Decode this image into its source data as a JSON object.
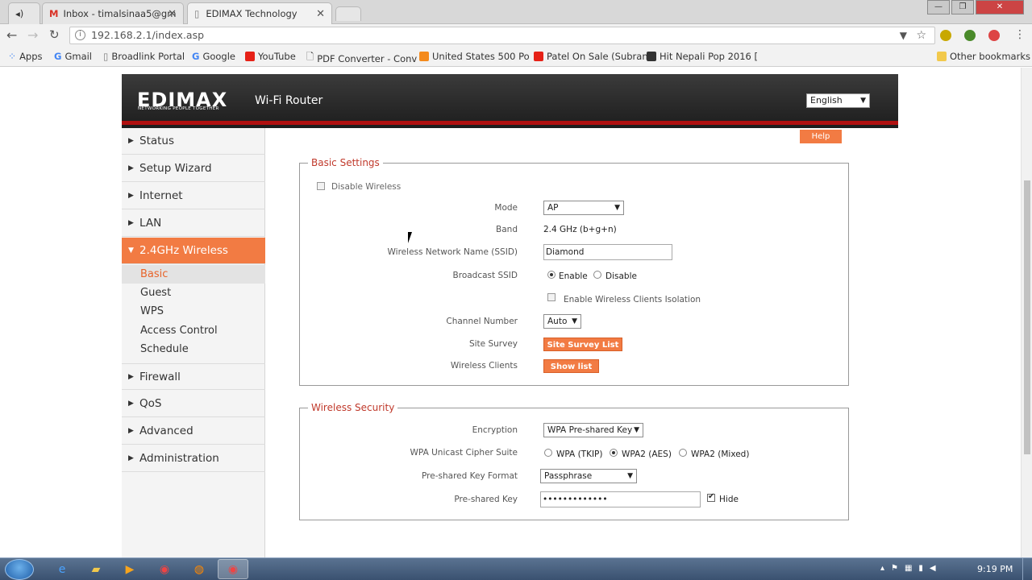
{
  "browser": {
    "tabs": [
      {
        "title": "Inbox - timalsinaa5@gm",
        "close": "✕"
      },
      {
        "title": "EDIMAX Technology",
        "close": "✕"
      }
    ],
    "url": "192.168.2.1/index.asp",
    "bookmarks": [
      {
        "label": "Apps",
        "icon": "apps-icon"
      },
      {
        "label": "Gmail",
        "icon": "google-icon"
      },
      {
        "label": "Broadlink Portal",
        "icon": "page-icon"
      },
      {
        "label": "Google",
        "icon": "google-icon"
      },
      {
        "label": "YouTube",
        "icon": "youtube-icon"
      },
      {
        "label": "PDF Converter - Conv",
        "icon": "pdf-icon"
      },
      {
        "label": "United States 500 Po",
        "icon": "bookmark-icon"
      },
      {
        "label": "Patel On Sale (Subran",
        "icon": "youtube-icon"
      },
      {
        "label": "Hit Nepali Pop 2016 [",
        "icon": "music-icon"
      }
    ],
    "other_bookmarks": "Other bookmarks"
  },
  "router": {
    "logo": "EDIMAX",
    "logo_tagline": "NETWORKING PEOPLE TOGETHER",
    "title": "Wi-Fi Router",
    "language": "English",
    "help": "Help"
  },
  "sidebar": {
    "items": [
      {
        "label": "Status"
      },
      {
        "label": "Setup Wizard"
      },
      {
        "label": "Internet"
      },
      {
        "label": "LAN"
      },
      {
        "label": "2.4GHz Wireless"
      },
      {
        "label": "Firewall"
      },
      {
        "label": "QoS"
      },
      {
        "label": "Advanced"
      },
      {
        "label": "Administration"
      }
    ],
    "subitems": [
      {
        "label": "Basic"
      },
      {
        "label": "Guest"
      },
      {
        "label": "WPS"
      },
      {
        "label": "Access Control"
      },
      {
        "label": "Schedule"
      }
    ]
  },
  "basic_settings": {
    "legend": "Basic Settings",
    "disable_wireless": "Disable  Wireless",
    "mode_label": "Mode",
    "mode_value": "AP",
    "band_label": "Band",
    "band_value": "2.4 GHz (b+g+n)",
    "ssid_label": "Wireless Network Name (SSID)",
    "ssid_value": "Diamond",
    "broadcast_label": "Broadcast SSID",
    "broadcast_enable": "Enable",
    "broadcast_disable": "Disable",
    "isolation_label": "Enable Wireless Clients Isolation",
    "channel_label": "Channel Number",
    "channel_value": "Auto",
    "site_survey_label": "Site Survey",
    "site_survey_button": "Site Survey List",
    "clients_label": "Wireless Clients",
    "clients_button": "Show list"
  },
  "wireless_security": {
    "legend": "Wireless  Security",
    "encryption_label": "Encryption",
    "encryption_value": "WPA Pre-shared Key",
    "cipher_label": "WPA Unicast Cipher Suite",
    "cipher_tkip": "WPA (TKIP)",
    "cipher_aes": "WPA2 (AES)",
    "cipher_mixed": "WPA2 (Mixed)",
    "key_format_label": "Pre-shared Key Format",
    "key_format_value": "Passphrase",
    "key_label": "Pre-shared Key",
    "key_value": "•••••••••••••",
    "hide_label": "Hide"
  },
  "taskbar": {
    "time": "9:19 PM"
  },
  "colors": {
    "accent": "#f27b43",
    "header_red": "#b01010",
    "legend_red": "#c0392b"
  }
}
